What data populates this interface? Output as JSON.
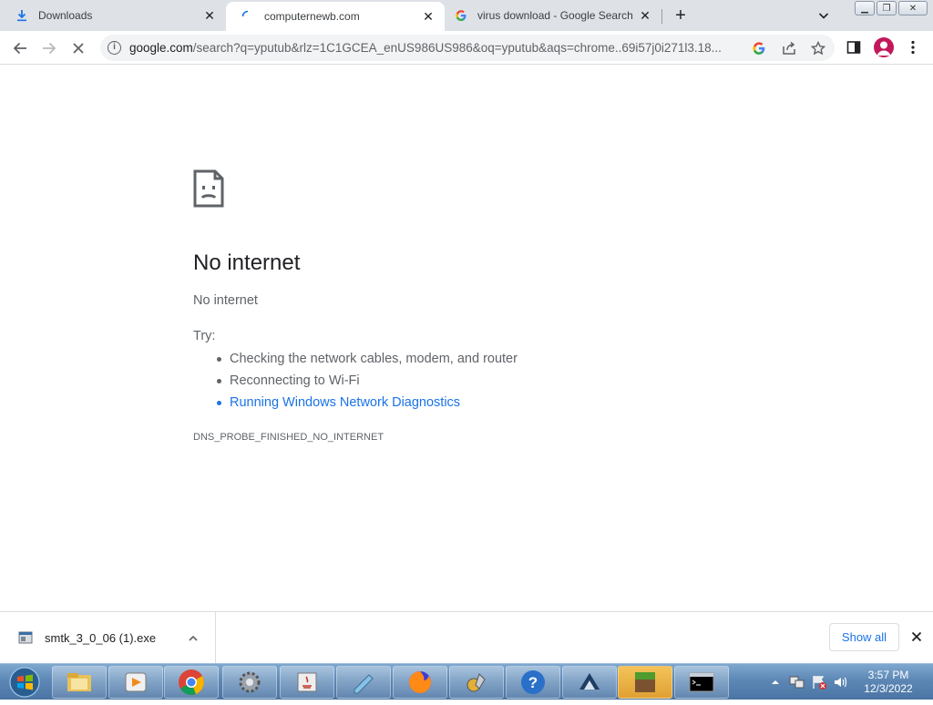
{
  "tabs": [
    {
      "label": "Downloads",
      "icon": "download-icon",
      "active": false
    },
    {
      "label": "computernewb.com",
      "icon": "loading-spinner-icon",
      "active": true
    },
    {
      "label": "virus download - Google Search",
      "icon": "google-g-icon",
      "active": false
    }
  ],
  "omnibox": {
    "url_host": "google.com",
    "url_rest": "/search?q=yputub&rlz=1C1GCEA_enUS986US986&oq=yputub&aqs=chrome..69i57j0i271l3.18..."
  },
  "error_page": {
    "title": "No internet",
    "subtitle": "No internet",
    "try_label": "Try:",
    "suggestions": [
      {
        "text": "Checking the network cables, modem, and router",
        "link": false
      },
      {
        "text": "Reconnecting to Wi-Fi",
        "link": false
      },
      {
        "text": "Running Windows Network Diagnostics",
        "link": true
      }
    ],
    "error_code": "DNS_PROBE_FINISHED_NO_INTERNET"
  },
  "download_bar": {
    "filename": "smtk_3_0_06 (1).exe",
    "show_all_label": "Show all"
  },
  "taskbar": {
    "apps": [
      "explorer-icon",
      "media-player-icon",
      "chrome-icon",
      "settings-gear-icon",
      "java-icon",
      "notepad-icon",
      "firefox-icon",
      "tools-icon",
      "help-icon",
      "vm-icon",
      "minecraft-icon",
      "cmd-icon"
    ],
    "time": "3:57 PM",
    "date": "12/3/2022"
  },
  "colors": {
    "link": "#1a73e8",
    "tabstrip": "#dee1e6",
    "avatar": "#c2185b"
  }
}
